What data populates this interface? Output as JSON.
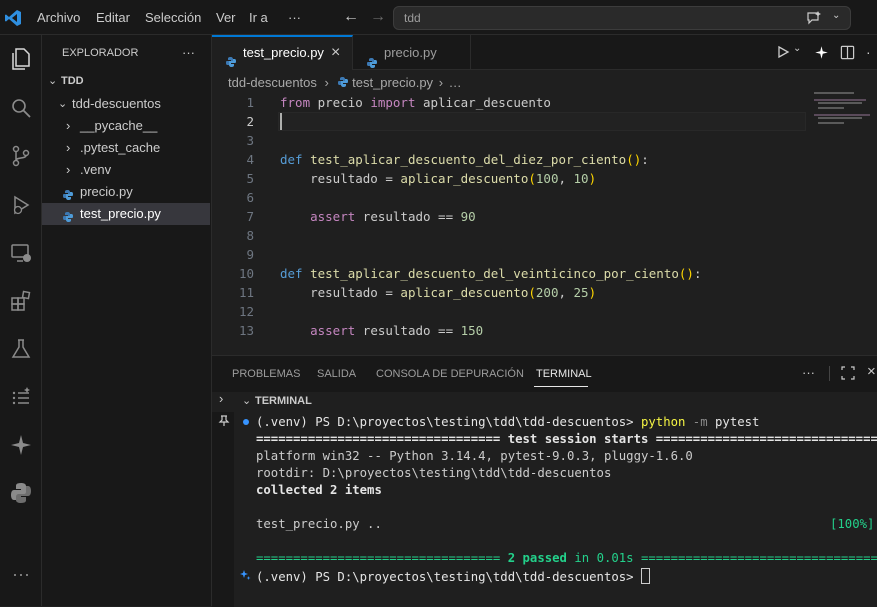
{
  "titlebar": {
    "menu": [
      "Archivo",
      "Editar",
      "Selección",
      "Ver",
      "Ir a",
      "···"
    ],
    "search": "tdd"
  },
  "sidebar": {
    "header": "EXPLORADOR",
    "more": "···",
    "folder": "TDD",
    "subfolder": "tdd-descuentos",
    "items": [
      {
        "label": "__pycache__",
        "type": "folder"
      },
      {
        "label": ".pytest_cache",
        "type": "folder"
      },
      {
        "label": ".venv",
        "type": "folder"
      },
      {
        "label": "precio.py",
        "type": "python-file"
      },
      {
        "label": "test_precio.py",
        "type": "python-file",
        "selected": true
      }
    ]
  },
  "tabs": [
    {
      "label": "test_precio.py",
      "active": true,
      "close": "×"
    },
    {
      "label": "precio.py",
      "active": false
    }
  ],
  "breadcrumb": {
    "folder": "tdd-descuentos",
    "sep": "›",
    "file": "test_precio.py",
    "more": "…"
  },
  "editor": {
    "line_numbers": [
      "1",
      "2",
      "3",
      "4",
      "5",
      "6",
      "7",
      "8",
      "9",
      "10",
      "11",
      "12",
      "13"
    ],
    "current_line": "2",
    "lines": {
      "l1": {
        "kw1": "from",
        "mod": " precio ",
        "kw2": "import",
        "rest": " aplicar_descuento"
      },
      "l4": {
        "def": "def",
        "name": "test_aplicar_descuento_del_diez_por_ciento",
        "parens": "()",
        "colon": ":"
      },
      "l5": {
        "pre": "    resultado = ",
        "fn": "aplicar_descuento",
        "open": "(",
        "a": "100",
        "comma": ", ",
        "b": "10",
        "close": ")"
      },
      "l7": {
        "pre": "    ",
        "kw": "assert",
        "mid": " resultado == ",
        "num": "90"
      },
      "l10": {
        "def": "def",
        "name": "test_aplicar_descuento_del_veinticinco_por_ciento",
        "parens": "()",
        "colon": ":"
      },
      "l11": {
        "pre": "    resultado = ",
        "fn": "aplicar_descuento",
        "open": "(",
        "a": "200",
        "comma": ", ",
        "b": "25",
        "close": ")"
      },
      "l13": {
        "pre": "    ",
        "kw": "assert",
        "mid": " resultado == ",
        "num": "150"
      }
    }
  },
  "panel": {
    "tabs": [
      "PROBLEMAS",
      "SALIDA",
      "CONSOLA DE DEPURACIÓN",
      "TERMINAL"
    ],
    "active_tab": "TERMINAL",
    "more": "···",
    "terminal_header": "TERMINAL",
    "terminal": {
      "prompt": "(.venv) PS D:\\proyectos\\testing\\tdd\\tdd-descuentos> ",
      "cmd_python": "python",
      "cmd_flag": " -m ",
      "cmd_arg": "pytest",
      "sep_start": "================================= test session starts =================================",
      "platform": "platform win32 -- Python 3.14.4, pytest-9.0.3, pluggy-1.6.0",
      "rootdir": "rootdir: D:\\proyectos\\testing\\tdd\\tdd-descuentos",
      "collected": "collected 2 items",
      "result_file": "test_precio.py ..",
      "result_pct": "[100%]",
      "sep_end_left": "================================= ",
      "passed": "2 passed",
      "in_time": " in 0.01s",
      "sep_end_right": " ==================================",
      "prompt2": "(.venv) PS D:\\proyectos\\testing\\tdd\\tdd-descuentos> "
    }
  },
  "colors": {
    "accent": "#0078d4",
    "terminal_green": "#23d18b",
    "terminal_yellow": "#f5f543",
    "keyword": "#c586c0",
    "function": "#dcdcaa"
  }
}
